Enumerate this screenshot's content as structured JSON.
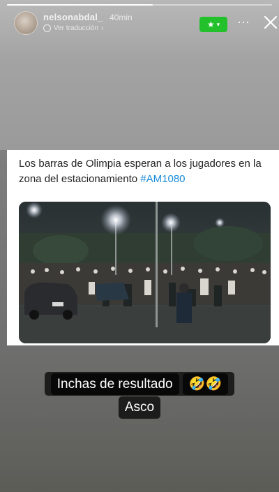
{
  "story": {
    "progress_fraction": 0.55,
    "username": "nelsonabdal_",
    "time_ago": "40min",
    "translate_label": "Ver traducción",
    "close_friends_badge": "★",
    "more_label": "⋯"
  },
  "post": {
    "text": "Los barras de Olimpia esperan a los jugadores en la zona del estacionamiento",
    "hashtag": "#AM1080"
  },
  "captions": {
    "line1_text": "Inchas de resultado",
    "line1_emoji": "🤣🤣",
    "line2_text": "Asco"
  },
  "colors": {
    "close_friends_green": "#22c02a",
    "hashtag_blue": "#1a8cd8"
  }
}
